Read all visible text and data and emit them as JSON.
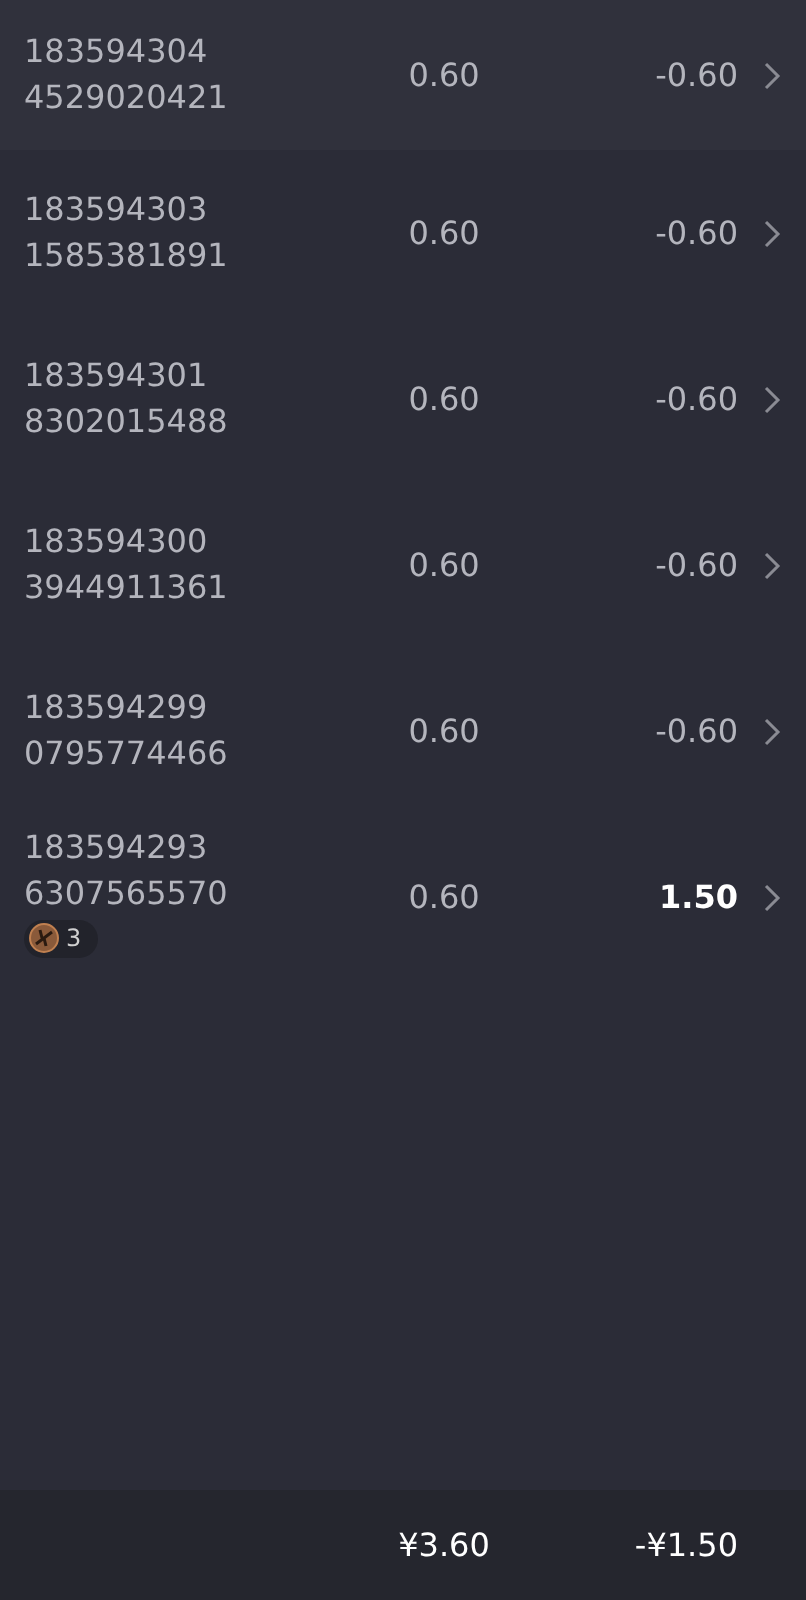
{
  "rows": [
    {
      "id_line_1": "183594304",
      "id_line_2": "4529020421",
      "stake": "0.60",
      "result": "-0.60",
      "won": false,
      "highlighted": true
    },
    {
      "id_line_1": "183594303",
      "id_line_2": "1585381891",
      "stake": "0.60",
      "result": "-0.60",
      "won": false,
      "highlighted": false
    },
    {
      "id_line_1": "183594301",
      "id_line_2": "8302015488",
      "stake": "0.60",
      "result": "-0.60",
      "won": false,
      "highlighted": false
    },
    {
      "id_line_1": "183594300",
      "id_line_2": "3944911361",
      "stake": "0.60",
      "result": "-0.60",
      "won": false,
      "highlighted": false
    },
    {
      "id_line_1": "183594299",
      "id_line_2": "0795774466",
      "stake": "0.60",
      "result": "-0.60",
      "won": false,
      "highlighted": false
    },
    {
      "id_line_1": "183594293",
      "id_line_2": "6307565570",
      "stake": "0.60",
      "result": "1.50",
      "won": true,
      "highlighted": false,
      "badge": {
        "count": "3"
      }
    }
  ],
  "footer": {
    "total_stake": "¥3.60",
    "total_result": "-¥1.50"
  }
}
